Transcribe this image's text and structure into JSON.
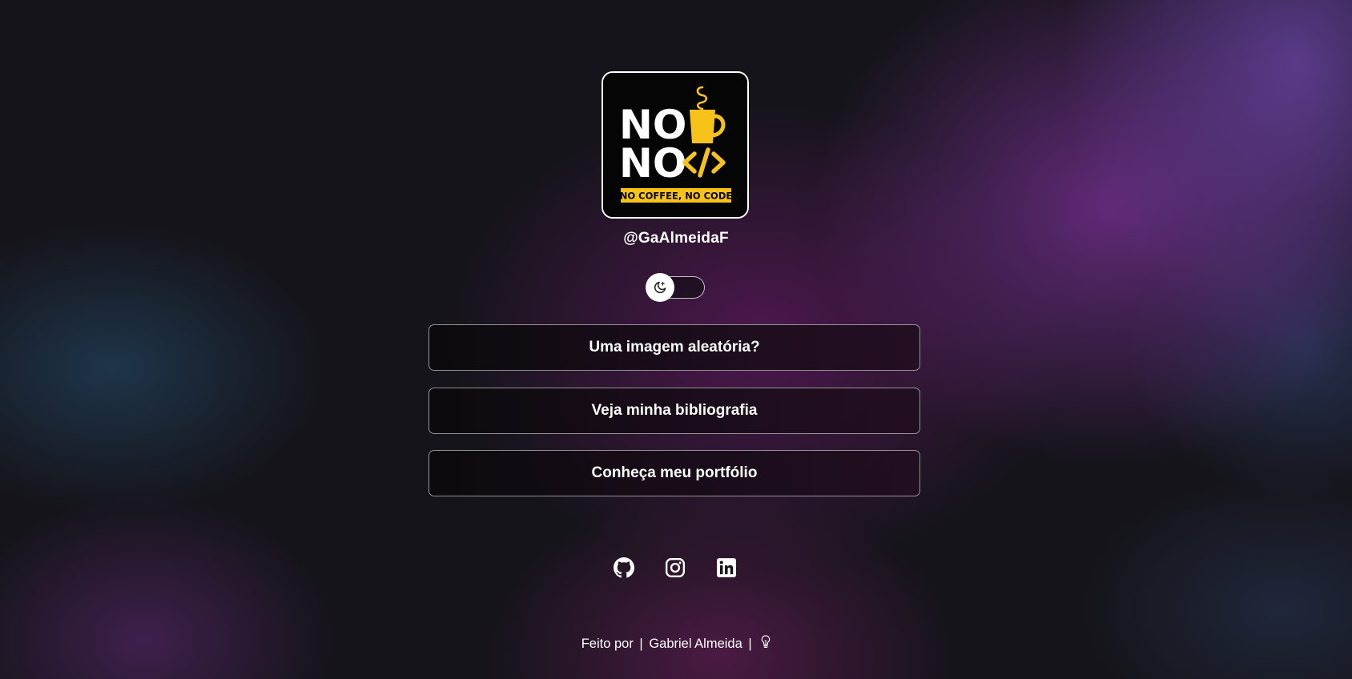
{
  "profile": {
    "logo_text": {
      "line1": "NO",
      "line2": "NO",
      "banner": "NO COFFEE, NO CODE"
    },
    "handle": "@GaAlmeidaF"
  },
  "theme_toggle": {
    "icon": "moon-stars-icon",
    "state": "dark"
  },
  "links": [
    {
      "label": "Uma imagem aleatória?"
    },
    {
      "label": "Veja minha bibliografia"
    },
    {
      "label": "Conheça meu portfólio"
    }
  ],
  "social": [
    {
      "icon": "github-icon"
    },
    {
      "icon": "instagram-icon"
    },
    {
      "icon": "linkedin-icon"
    }
  ],
  "footer": {
    "prefix": "Feito por",
    "separator": "|",
    "author": "Gabriel Almeida",
    "icon": "lightbulb-icon"
  },
  "colors": {
    "logo_accent": "#f7c21a",
    "logo_background": "#050505",
    "text": "#ffffff"
  }
}
